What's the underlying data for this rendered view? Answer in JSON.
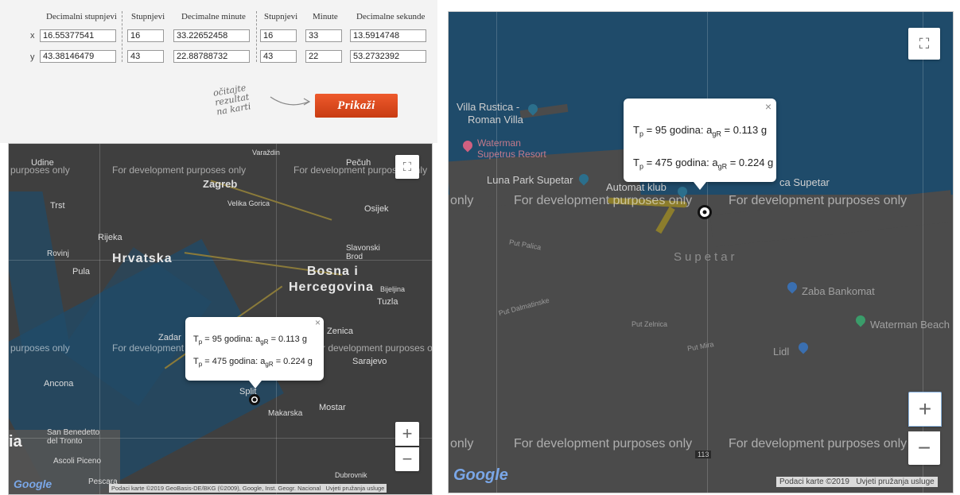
{
  "converter": {
    "headers": {
      "decimal_degrees": "Decimalni stupnjevi",
      "degrees_1": "Stupnjevi",
      "decimal_minutes": "Decimalne minute",
      "degrees_2": "Stupnjevi",
      "minutes": "Minute",
      "decimal_seconds": "Decimalne sekunde"
    },
    "rows": [
      {
        "label": "x",
        "decimal_degrees": "16.55377541",
        "degrees_1": "16",
        "decimal_minutes": "33.22652458",
        "degrees_2": "16",
        "minutes": "33",
        "decimal_seconds": "13.5914748"
      },
      {
        "label": "y",
        "decimal_degrees": "43.38146479",
        "degrees_1": "43",
        "decimal_minutes": "22.88788732",
        "degrees_2": "43",
        "minutes": "22",
        "decimal_seconds": "53.2732392"
      }
    ],
    "hint": [
      "očitajte",
      "rezultat",
      "na karti"
    ],
    "show_button": "Prikaži"
  },
  "watermark": "For development purposes only",
  "watermark_short": "purposes only",
  "watermark_only": "only",
  "popup": {
    "line1_prefix": "T",
    "line1_sub": "p",
    "line1_text": " =  95 godina: a",
    "line1_sub2": "gR",
    "line1_value": " = 0.113 g",
    "line2_prefix": "T",
    "line2_sub": "p",
    "line2_text": " = 475 godina: a",
    "line2_sub2": "gR",
    "line2_value": " = 0.224 g",
    "close": "×"
  },
  "map_left": {
    "labels": {
      "zagreb": "Zagreb",
      "hrvatska": "Hrvatska",
      "bosna": "Bosna i",
      "hercegovina": "Hercegovina",
      "rijeka": "Rijeka",
      "trst": "Trst",
      "pula": "Pula",
      "rovinj": "Rovinj",
      "udine": "Udine",
      "pecuh": "Pečuh",
      "osijek": "Osijek",
      "varazdin": "Varaždin",
      "velika_gorica": "Velika Gorica",
      "slavonski_brod": "Slavonski Brod",
      "bijeljina": "Bijeljina",
      "tuzla": "Tuzla",
      "zenica": "Zenica",
      "sarajevo": "Sarajevo",
      "mostar": "Mostar",
      "makarska": "Makarska",
      "split": "Split",
      "zadar": "Zadar",
      "ancona": "Ancona",
      "san_benedetto": "San Benedetto del Tronto",
      "ascoli": "Ascoli Piceno",
      "pescara": "Pescara",
      "dubrovnik": "Dubrovnik",
      "italia_frag": "ia"
    },
    "attribution": "Podaci karte ©2019 GeoBasis-DE/BKG (©2009), Google, Inst. Geogr. Nacional",
    "terms": "Uvjeti pružanja usluge",
    "zoom_in": "+",
    "zoom_out": "−",
    "fullscreen": "⛶",
    "google": "Google"
  },
  "map_right": {
    "labels": {
      "villa": "Villa Rustica -",
      "villa2": "Roman Villa",
      "waterman_resort": "Waterman",
      "waterman_resort2": "Supetrus Resort",
      "luna_park": "Luna Park Supetar",
      "automat": "Automat klub",
      "supetar_road": "ca Supetar",
      "supetar": "Supetar",
      "zaba": "Zaba Bankomat",
      "waterman_beach": "Waterman Beach",
      "lidl": "Lidl",
      "put_palica": "Put Palica",
      "put_dalmatinske": "Put Dalmatinske",
      "put_mira": "Put Mira",
      "put_zelnica": "Put Zelnica",
      "road_113": "113"
    },
    "attribution": "Podaci karte ©2019",
    "terms": "Uvjeti pružanja usluge",
    "zoom_in": "+",
    "zoom_out": "−",
    "fullscreen": "⛶",
    "google": "Google"
  },
  "colors": {
    "button": "#d9461b",
    "sea": "#1f4b6a",
    "land": "#4b4b4b"
  }
}
